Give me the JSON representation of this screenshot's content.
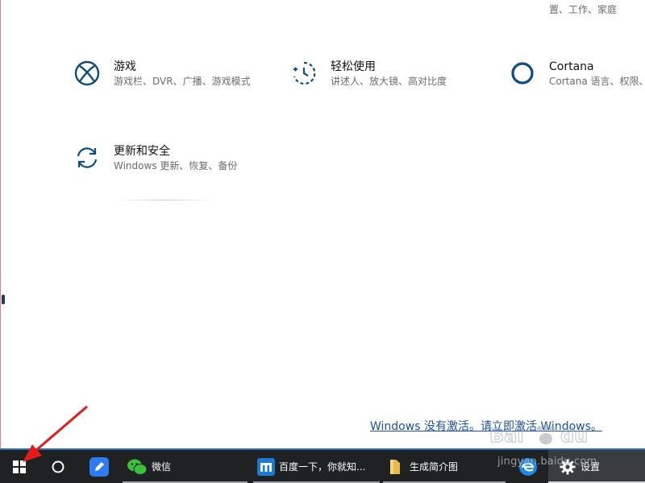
{
  "top_partial": {
    "col1": "",
    "col2": "",
    "col3": "置、工作、家庭"
  },
  "tiles": [
    {
      "title": "游戏",
      "desc": "游戏栏、DVR、广播、游戏模式",
      "icon": "xbox-icon"
    },
    {
      "title": "轻松使用",
      "desc": "讲述人、放大镜、高对比度",
      "icon": "ease-of-access-icon"
    },
    {
      "title": "Cortana",
      "desc": "Cortana 语言、权限、",
      "icon": "cortana-icon"
    },
    {
      "title": "更新和安全",
      "desc": "Windows 更新、恢复、备份",
      "icon": "update-sync-icon"
    }
  ],
  "activation_text": "Windows 没有激活。请立即激活 Windows。",
  "watermark": "jingyan.baidu.com",
  "taskbar": {
    "items": [
      {
        "label": "微信",
        "icon": "wechat-icon"
      },
      {
        "label": "百度一下，你就知...",
        "icon": "maxthon-browser-icon"
      },
      {
        "label": "生成简介图",
        "icon": "folder-icon"
      },
      {
        "label": "设置",
        "icon": "gear-icon"
      }
    ]
  },
  "colors": {
    "accent": "#0b4d84",
    "taskbar": "#1f2122",
    "link": "#1c4fa0",
    "arrow": "#e21b1b"
  }
}
